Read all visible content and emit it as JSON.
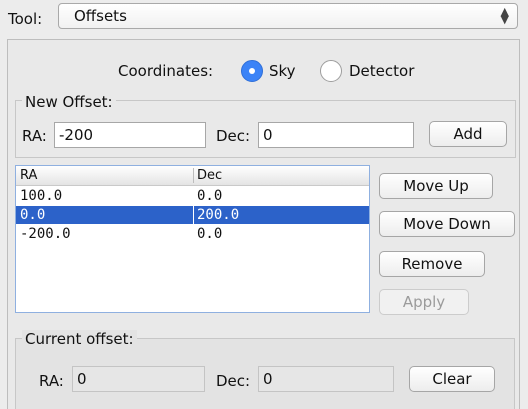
{
  "tool": {
    "label": "Tool:",
    "selected": "Offsets",
    "arrow": "▲▼"
  },
  "coordinates": {
    "label": "Coordinates:",
    "options": [
      {
        "label": "Sky",
        "selected": true
      },
      {
        "label": "Detector",
        "selected": false
      }
    ]
  },
  "new_offset": {
    "title": "New Offset:",
    "ra_label": "RA:",
    "ra_value": "-200",
    "dec_label": "Dec:",
    "dec_value": "0",
    "add_label": "Add"
  },
  "table": {
    "columns": [
      "RA",
      "Dec"
    ],
    "rows": [
      {
        "ra": "100.0",
        "dec": "0.0",
        "selected": false
      },
      {
        "ra": "0.0",
        "dec": "200.0",
        "selected": true
      },
      {
        "ra": "-200.0",
        "dec": "0.0",
        "selected": false
      }
    ]
  },
  "actions": {
    "move_up": "Move Up",
    "move_down": "Move Down",
    "remove": "Remove",
    "apply": "Apply"
  },
  "current_offset": {
    "title": "Current offset:",
    "ra_label": "RA:",
    "ra_value": "0",
    "dec_label": "Dec:",
    "dec_value": "0",
    "clear_label": "Clear"
  },
  "colors": {
    "selection": "#2c62c9",
    "radio_accent": "#3b83f7"
  }
}
